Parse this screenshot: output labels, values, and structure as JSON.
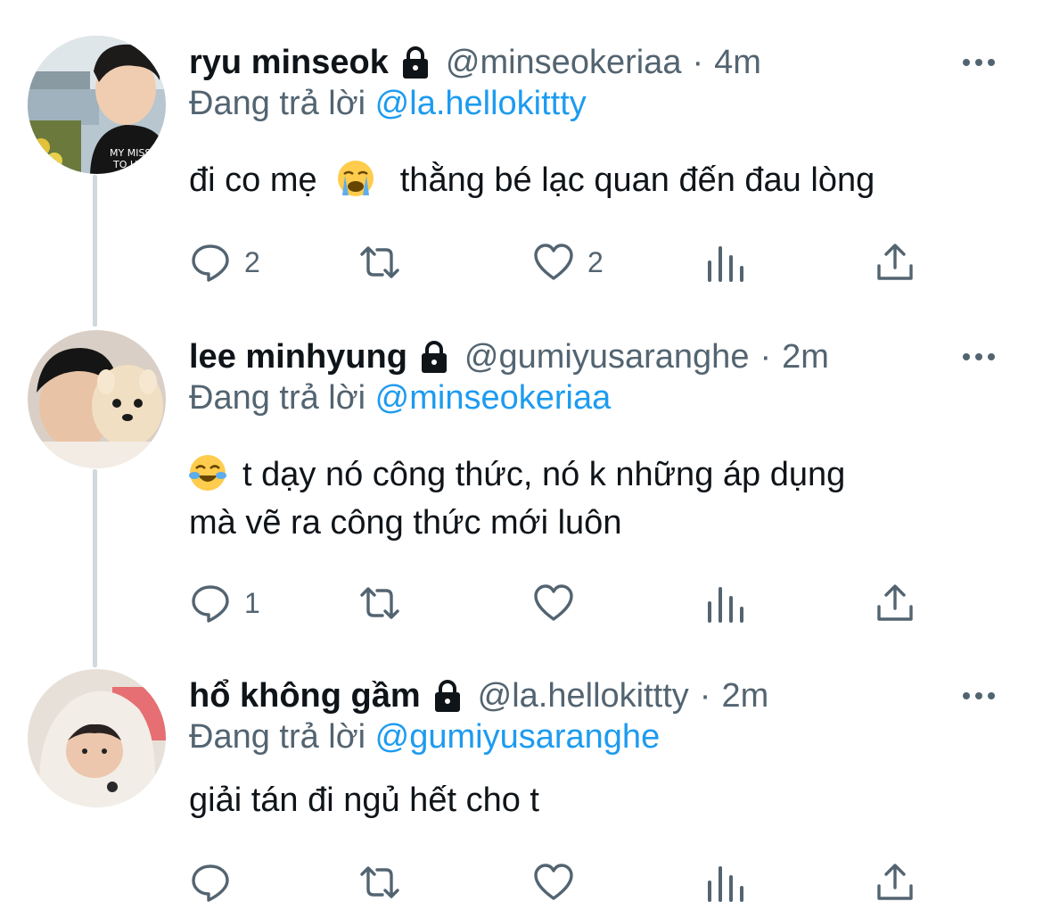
{
  "reply_prefix": "Đang trả lời",
  "tweets": [
    {
      "display_name": "ryu minseok",
      "handle": "@minseokeriaa",
      "separator": "·",
      "time": "4m",
      "reply_to": "@la.hellokittty",
      "text_before_emoji": "đi co mẹ",
      "emoji": "loudly-crying-face",
      "text_after_emoji": "thằng bé lạc quan đến đau lòng",
      "reply_count": "2",
      "retweet_count": "",
      "like_count": "2"
    },
    {
      "display_name": "lee minhyung",
      "handle": "@gumiyusaranghe",
      "separator": "·",
      "time": "2m",
      "reply_to": "@minseokeriaa",
      "emoji": "face-with-tears-of-joy",
      "text_line1": "t dạy nó công thức, nó k những áp dụng",
      "text_line2": "mà vẽ ra công thức mới luôn",
      "reply_count": "1",
      "retweet_count": "",
      "like_count": ""
    },
    {
      "display_name": "hổ không gầm",
      "handle": "@la.hellokittty",
      "separator": "·",
      "time": "2m",
      "reply_to": "@gumiyusaranghe",
      "text": "giải tán đi ngủ hết cho t",
      "reply_count": "",
      "retweet_count": "",
      "like_count": ""
    }
  ],
  "icons": {
    "reply": "speech-bubble-icon",
    "retweet": "retweet-arrows-icon",
    "like": "heart-icon",
    "analytics": "bar-chart-icon",
    "share": "share-upload-icon",
    "more": "more-dots-icon",
    "protected": "lock-icon"
  },
  "colors": {
    "text": "#0f1419",
    "secondary": "#536471",
    "link": "#1d9bf0",
    "thread_line": "#cfd9de"
  }
}
